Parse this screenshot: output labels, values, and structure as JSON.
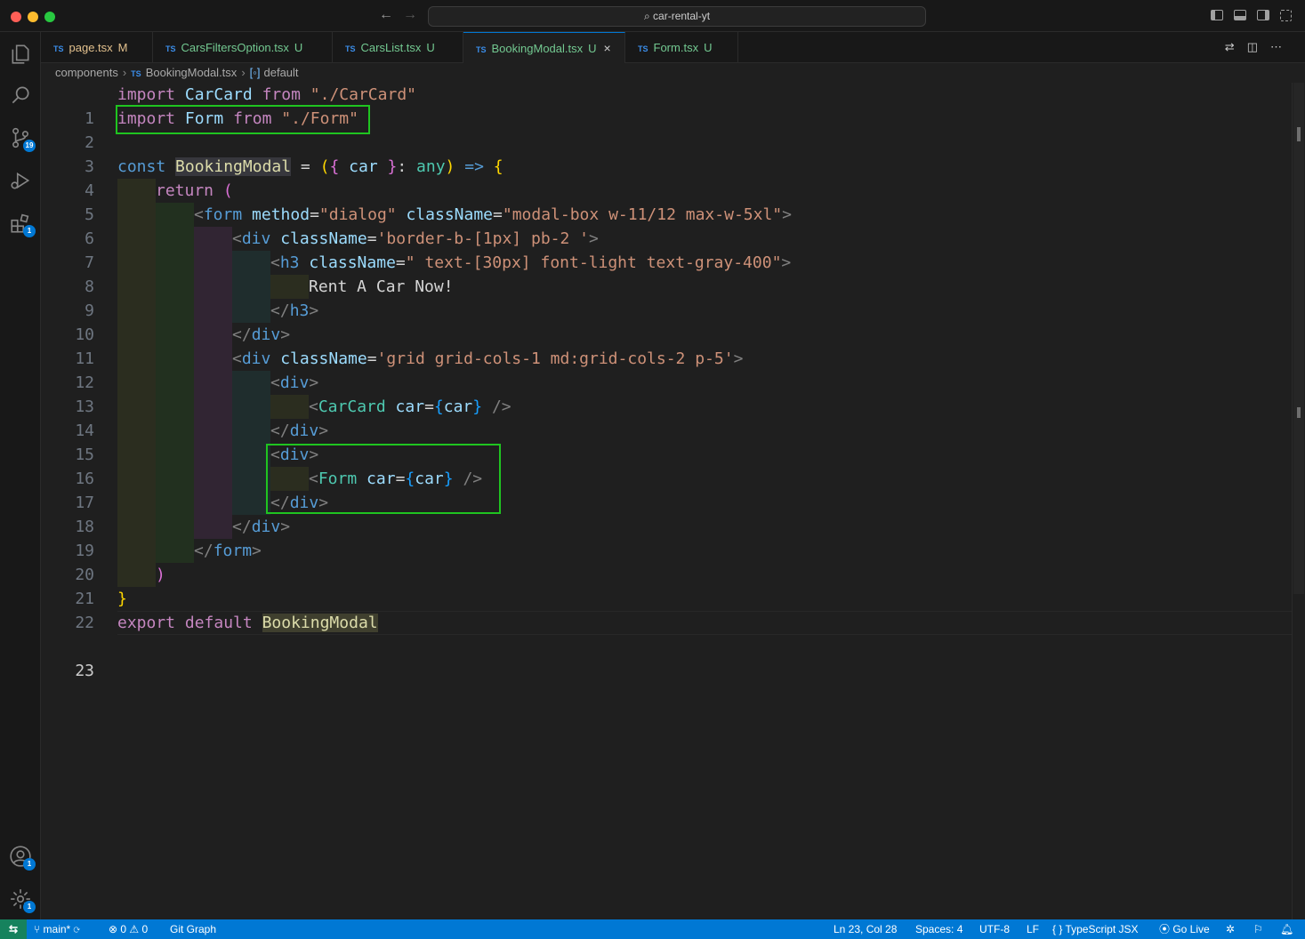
{
  "window": {
    "title": "car-rental-yt"
  },
  "tabs": [
    {
      "label": "page.tsx",
      "flag": "M",
      "state": "modified"
    },
    {
      "label": "CarsFiltersOption.tsx",
      "flag": "U",
      "state": "untracked"
    },
    {
      "label": "CarsList.tsx",
      "flag": "U",
      "state": "untracked"
    },
    {
      "label": "BookingModal.tsx",
      "flag": "U",
      "state": "active",
      "close": "×"
    },
    {
      "label": "Form.tsx",
      "flag": "U",
      "state": "untracked"
    }
  ],
  "ts_badge": "TS",
  "breadcrumbs": {
    "folder": "components",
    "file": "BookingModal.tsx",
    "symbol": "default"
  },
  "activitybar": {
    "scm_badge": "19",
    "extensions_badge": "1",
    "accounts_badge": "1",
    "settings_badge": "1"
  },
  "editor": {
    "current_line": 23,
    "line_numbers": [
      "1",
      "2",
      "3",
      "4",
      "5",
      "6",
      "7",
      "8",
      "9",
      "10",
      "11",
      "12",
      "13",
      "14",
      "15",
      "16",
      "17",
      "18",
      "19",
      "20",
      "21",
      "22",
      "23"
    ],
    "tokens": {
      "import": "import",
      "from": "from",
      "const": "const",
      "return": "return",
      "export": "export",
      "default": "default",
      "CarCard": "CarCard",
      "Form": "Form",
      "BookingModal": "BookingModal",
      "car_card_path": "\"./CarCard\"",
      "form_path": "\"./Form\"",
      "car": "car",
      "any": "any",
      "form_tag": "form",
      "div_tag": "div",
      "h3_tag": "h3",
      "method": "method",
      "className": "className",
      "dialog": "\"dialog\"",
      "modal_cls": "\"modal-box w-11/12 max-w-5xl\"",
      "border_cls": "'border-b-[1px] pb-2 '",
      "h3_cls": "\" text-[30px] font-light text-gray-400\"",
      "heading_text": "Rent A Car Now!",
      "grid_cls": "'grid grid-cols-1 md:grid-cols-2 p-5'"
    }
  },
  "statusbar": {
    "branch": "main*",
    "errors": "0",
    "warnings": "0",
    "git_graph": "Git Graph",
    "position": "Ln 23, Col 28",
    "spaces": "Spaces: 4",
    "encoding": "UTF-8",
    "eol": "LF",
    "language": "TypeScript JSX",
    "go_live": "Go Live"
  },
  "colors": {
    "accent": "#0078d4",
    "highlight_box": "#1fc420",
    "editor_bg": "#1f1f1f"
  }
}
